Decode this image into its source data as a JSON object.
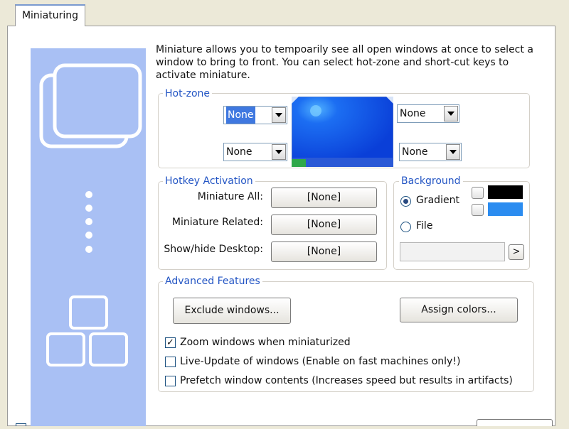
{
  "tab": {
    "label": "Miniaturing"
  },
  "description": "Miniature allows you to tempoarily see all open windows at once to select a window to bring to front. You can select hot-zone and short-cut keys to activate miniature.",
  "hotzone": {
    "title": "Hot-zone",
    "top_left": "None",
    "bottom_left": "None",
    "top_right": "None",
    "bottom_right": "None"
  },
  "hotkeys": {
    "title": "Hotkey Activation",
    "rows": [
      {
        "label": "Miniature All:",
        "value": "[None]"
      },
      {
        "label": "Miniature Related:",
        "value": "[None]"
      },
      {
        "label": "Show/hide Desktop:",
        "value": "[None]"
      }
    ]
  },
  "background": {
    "title": "Background",
    "gradient_label": "Gradient",
    "file_label": "File",
    "browse_label": ">",
    "file_path": "",
    "color1": "#000000",
    "color2": "#2b8cf0"
  },
  "advanced": {
    "title": "Advanced Features",
    "exclude_label": "Exclude windows...",
    "assign_label": "Assign colors...",
    "options": [
      {
        "label": "Zoom windows when miniaturized",
        "checked": true
      },
      {
        "label": "Live-Update of windows (Enable on fast machines only!)",
        "checked": false
      },
      {
        "label": "Prefetch window contents (Increases speed but results in artifacts)",
        "checked": false
      }
    ]
  },
  "colors": {
    "accent": "#2355c4",
    "sidebar": "#a9c0f4",
    "checked_mark": "✓"
  }
}
